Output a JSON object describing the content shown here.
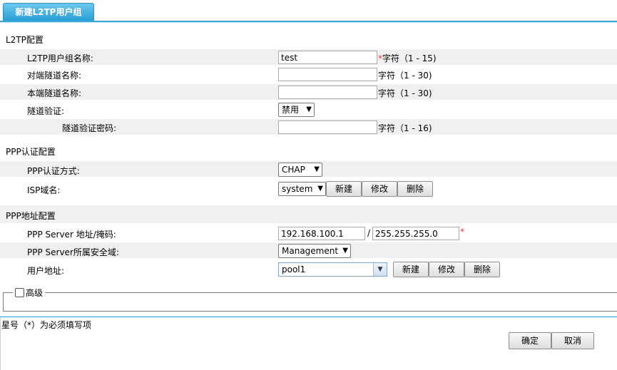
{
  "tab": {
    "title": "新建L2TP用户组"
  },
  "l2tp": {
    "section_title": "L2TP配置",
    "group_name": {
      "label": "L2TP用户组名称:",
      "value": "test",
      "required": "*",
      "hint": "字符（1 - 15)"
    },
    "peer_tunnel": {
      "label": "对端隧道名称:",
      "value": "",
      "hint": "字符（1 - 30)"
    },
    "local_tunnel": {
      "label": "本端隧道名称:",
      "value": "",
      "hint": "字符（1 - 30)"
    },
    "tunnel_auth": {
      "label": "隧道验证:",
      "selected": "禁用"
    },
    "tunnel_password": {
      "label": "隧道验证密码:",
      "value": "",
      "hint": "字符（1 - 16)"
    }
  },
  "ppp_auth": {
    "section_title": "PPP认证配置",
    "method": {
      "label": "PPP认证方式:",
      "selected": "CHAP"
    },
    "isp": {
      "label": "ISP域名:",
      "selected": "system",
      "new": "新建",
      "edit": "修改",
      "delete": "删除"
    }
  },
  "ppp_addr": {
    "section_title": "PPP地址配置",
    "server": {
      "label": "PPP Server 地址/掩码:",
      "address": "192.168.100.1",
      "separator": "/",
      "mask": "255.255.255.0",
      "required": "*"
    },
    "zone": {
      "label": "PPP Server所属安全域:",
      "selected": "Management"
    },
    "user_addr": {
      "label": "用户地址:",
      "selected": "pool1",
      "new": "新建",
      "edit": "修改",
      "delete": "删除"
    }
  },
  "advanced": {
    "label": "高级",
    "checked": false
  },
  "footer": {
    "note": "星号（*）为必须填写项",
    "ok": "确定",
    "cancel": "取消"
  },
  "colors": {
    "accent": "#2a9fd6",
    "row_bg": "#f0f0f0",
    "required": "#e33333"
  },
  "icons": {
    "dropdown": "chevron-down-icon"
  }
}
